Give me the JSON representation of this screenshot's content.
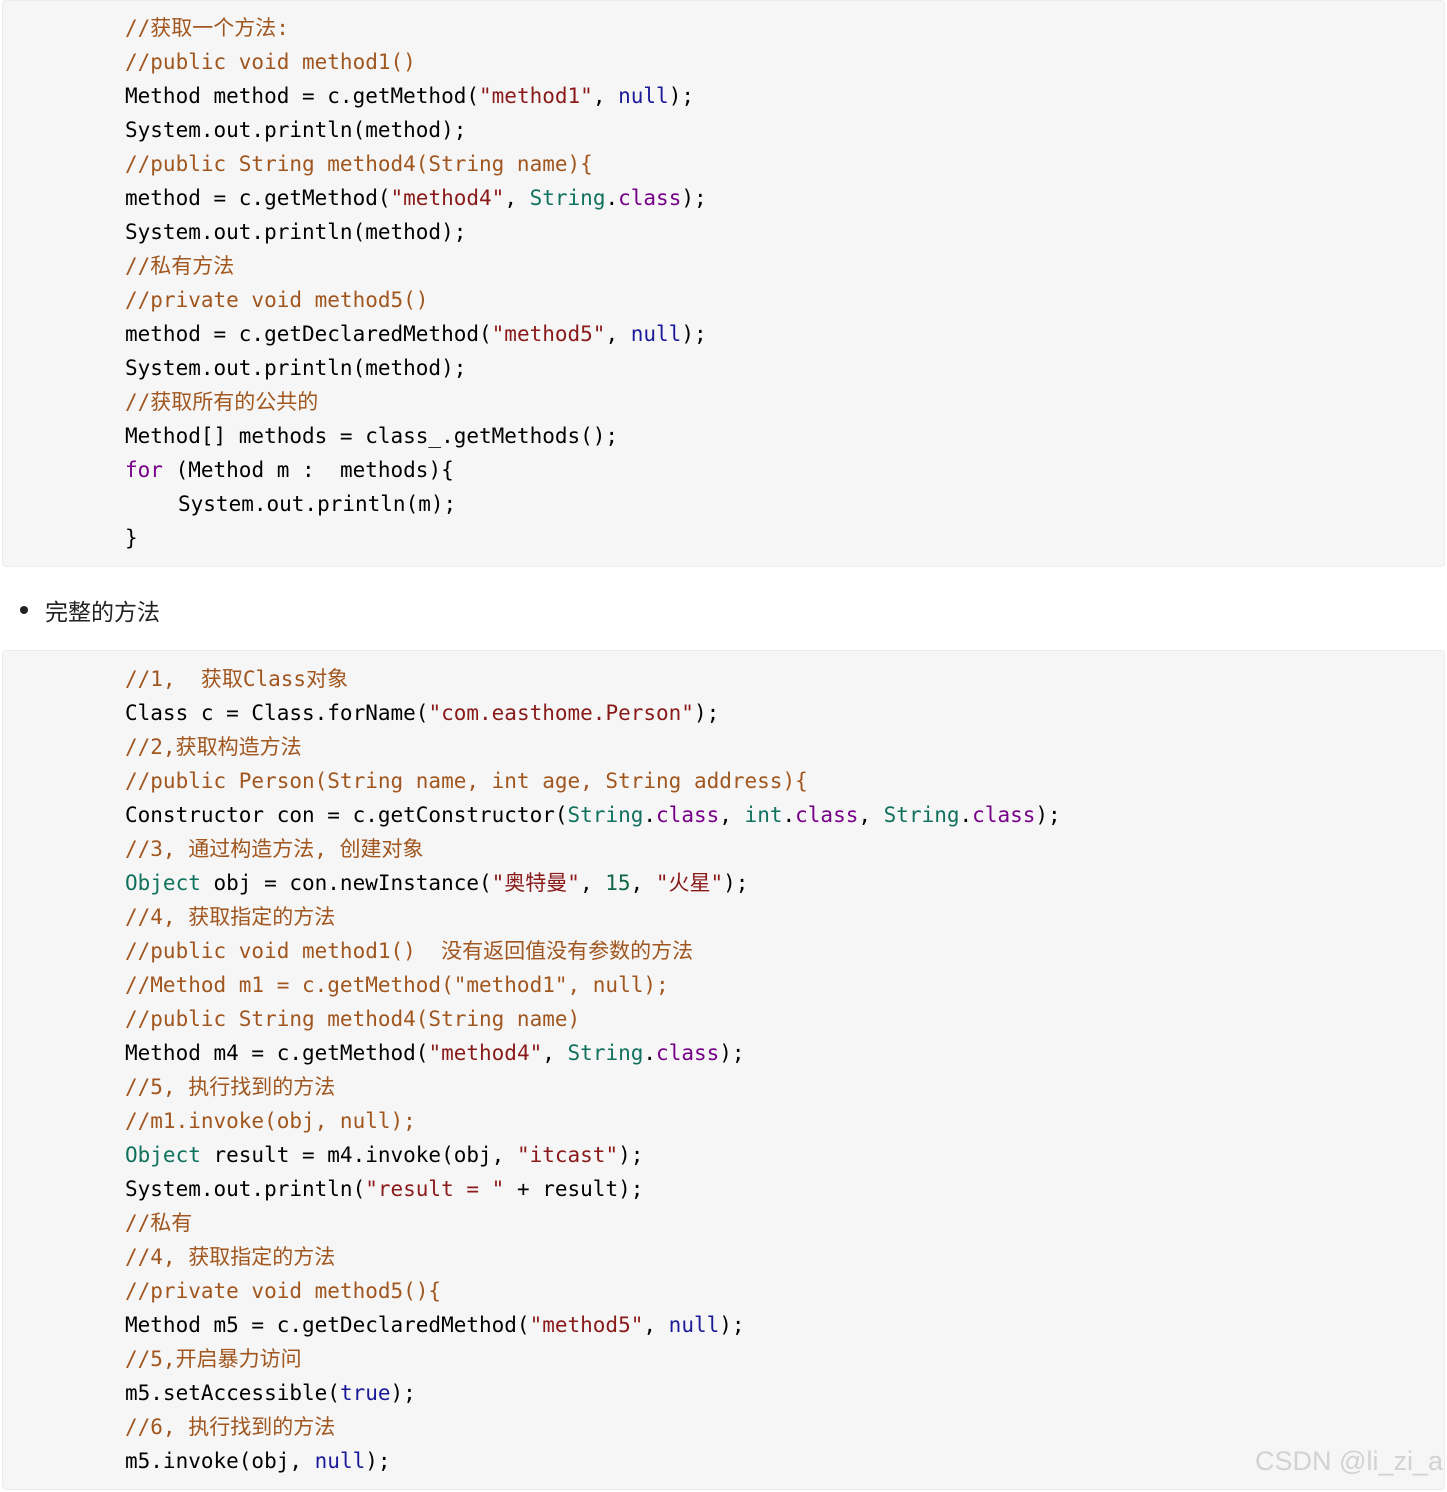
{
  "block1": {
    "lines": [
      {
        "indent": 0,
        "tokens": [
          {
            "t": "//获取一个方法:",
            "c": "comment"
          }
        ]
      },
      {
        "indent": 0,
        "tokens": [
          {
            "t": "//public void method1()",
            "c": "comment"
          }
        ]
      },
      {
        "indent": 0,
        "tokens": [
          {
            "t": "Method method = c.getMethod(",
            "c": ""
          },
          {
            "t": "\"method1\"",
            "c": "string"
          },
          {
            "t": ", ",
            "c": ""
          },
          {
            "t": "null",
            "c": "lit"
          },
          {
            "t": ");",
            "c": ""
          }
        ]
      },
      {
        "indent": 0,
        "tokens": [
          {
            "t": "System.out.println(method);",
            "c": ""
          }
        ]
      },
      {
        "indent": 0,
        "tokens": [
          {
            "t": "//public String method4(String name){",
            "c": "comment"
          }
        ]
      },
      {
        "indent": 0,
        "tokens": [
          {
            "t": "method = c.getMethod(",
            "c": ""
          },
          {
            "t": "\"method4\"",
            "c": "string"
          },
          {
            "t": ", ",
            "c": ""
          },
          {
            "t": "String",
            "c": "type"
          },
          {
            "t": ".",
            "c": ""
          },
          {
            "t": "class",
            "c": "kw"
          },
          {
            "t": ");",
            "c": ""
          }
        ]
      },
      {
        "indent": 0,
        "tokens": [
          {
            "t": "System.out.println(method);",
            "c": ""
          }
        ]
      },
      {
        "indent": 0,
        "tokens": [
          {
            "t": "//私有方法",
            "c": "comment"
          }
        ]
      },
      {
        "indent": 0,
        "tokens": [
          {
            "t": "//private void method5()",
            "c": "comment"
          }
        ]
      },
      {
        "indent": 0,
        "tokens": [
          {
            "t": "method = c.getDeclaredMethod(",
            "c": ""
          },
          {
            "t": "\"method5\"",
            "c": "string"
          },
          {
            "t": ", ",
            "c": ""
          },
          {
            "t": "null",
            "c": "lit"
          },
          {
            "t": ");",
            "c": ""
          }
        ]
      },
      {
        "indent": 0,
        "tokens": [
          {
            "t": "System.out.println(method);",
            "c": ""
          }
        ]
      },
      {
        "indent": 0,
        "tokens": [
          {
            "t": "//获取所有的公共的",
            "c": "comment"
          }
        ]
      },
      {
        "indent": 0,
        "tokens": [
          {
            "t": "Method[] methods = class_.getMethods();",
            "c": ""
          }
        ]
      },
      {
        "indent": 0,
        "tokens": [
          {
            "t": "for",
            "c": "kw"
          },
          {
            "t": " (Method m :  methods){",
            "c": ""
          }
        ]
      },
      {
        "indent": 1,
        "tokens": [
          {
            "t": "System.out.println(m);",
            "c": ""
          }
        ]
      },
      {
        "indent": 0,
        "tokens": [
          {
            "t": "}",
            "c": ""
          }
        ]
      }
    ]
  },
  "bullet": {
    "text": "完整的方法"
  },
  "block2": {
    "lines": [
      {
        "indent": 0,
        "tokens": [
          {
            "t": "//1,  获取Class对象",
            "c": "comment"
          }
        ]
      },
      {
        "indent": 0,
        "tokens": [
          {
            "t": "Class c = Class.forName(",
            "c": ""
          },
          {
            "t": "\"com.easthome.Person\"",
            "c": "string"
          },
          {
            "t": ");",
            "c": ""
          }
        ]
      },
      {
        "indent": 0,
        "tokens": [
          {
            "t": "//2,获取构造方法",
            "c": "comment"
          }
        ]
      },
      {
        "indent": 0,
        "tokens": [
          {
            "t": "//public Person(String name, int age, String address){",
            "c": "comment"
          }
        ]
      },
      {
        "indent": 0,
        "tokens": [
          {
            "t": "Constructor con = c.getConstructor(",
            "c": ""
          },
          {
            "t": "String",
            "c": "type"
          },
          {
            "t": ".",
            "c": ""
          },
          {
            "t": "class",
            "c": "kw"
          },
          {
            "t": ", ",
            "c": ""
          },
          {
            "t": "int",
            "c": "type"
          },
          {
            "t": ".",
            "c": ""
          },
          {
            "t": "class",
            "c": "kw"
          },
          {
            "t": ", ",
            "c": ""
          },
          {
            "t": "String",
            "c": "type"
          },
          {
            "t": ".",
            "c": ""
          },
          {
            "t": "class",
            "c": "kw"
          },
          {
            "t": ");",
            "c": ""
          }
        ]
      },
      {
        "indent": 0,
        "tokens": [
          {
            "t": "//3, 通过构造方法, 创建对象",
            "c": "comment"
          }
        ]
      },
      {
        "indent": 0,
        "tokens": [
          {
            "t": "Object",
            "c": "type"
          },
          {
            "t": " obj = con.newInstance(",
            "c": ""
          },
          {
            "t": "\"奥特曼\"",
            "c": "string"
          },
          {
            "t": ", ",
            "c": ""
          },
          {
            "t": "15",
            "c": "num"
          },
          {
            "t": ", ",
            "c": ""
          },
          {
            "t": "\"火星\"",
            "c": "string"
          },
          {
            "t": ");",
            "c": ""
          }
        ]
      },
      {
        "indent": 0,
        "tokens": [
          {
            "t": "//4, 获取指定的方法",
            "c": "comment"
          }
        ]
      },
      {
        "indent": 0,
        "tokens": [
          {
            "t": "//public void method1()  没有返回值没有参数的方法",
            "c": "comment"
          }
        ]
      },
      {
        "indent": 0,
        "tokens": [
          {
            "t": "//Method m1 = c.getMethod(\"method1\", null);",
            "c": "comment"
          }
        ]
      },
      {
        "indent": 0,
        "tokens": [
          {
            "t": "//public String method4(String name)",
            "c": "comment"
          }
        ]
      },
      {
        "indent": 0,
        "tokens": [
          {
            "t": "Method m4 = c.getMethod(",
            "c": ""
          },
          {
            "t": "\"method4\"",
            "c": "string"
          },
          {
            "t": ", ",
            "c": ""
          },
          {
            "t": "String",
            "c": "type"
          },
          {
            "t": ".",
            "c": ""
          },
          {
            "t": "class",
            "c": "kw"
          },
          {
            "t": ");",
            "c": ""
          }
        ]
      },
      {
        "indent": 0,
        "tokens": [
          {
            "t": "//5, 执行找到的方法",
            "c": "comment"
          }
        ]
      },
      {
        "indent": 0,
        "tokens": [
          {
            "t": "//m1.invoke(obj, null);",
            "c": "comment"
          }
        ]
      },
      {
        "indent": 0,
        "tokens": [
          {
            "t": "Object",
            "c": "type"
          },
          {
            "t": " result = m4.invoke(obj, ",
            "c": ""
          },
          {
            "t": "\"itcast\"",
            "c": "string"
          },
          {
            "t": ");",
            "c": ""
          }
        ]
      },
      {
        "indent": 0,
        "tokens": [
          {
            "t": "System.out.println(",
            "c": ""
          },
          {
            "t": "\"result = \"",
            "c": "string"
          },
          {
            "t": " + result);",
            "c": ""
          }
        ]
      },
      {
        "indent": 0,
        "tokens": [
          {
            "t": "//私有",
            "c": "comment"
          }
        ]
      },
      {
        "indent": 0,
        "tokens": [
          {
            "t": "//4, 获取指定的方法",
            "c": "comment"
          }
        ]
      },
      {
        "indent": 0,
        "tokens": [
          {
            "t": "//private void method5(){",
            "c": "comment"
          }
        ]
      },
      {
        "indent": 0,
        "tokens": [
          {
            "t": "Method m5 = c.getDeclaredMethod(",
            "c": ""
          },
          {
            "t": "\"method5\"",
            "c": "string"
          },
          {
            "t": ", ",
            "c": ""
          },
          {
            "t": "null",
            "c": "lit"
          },
          {
            "t": ");",
            "c": ""
          }
        ]
      },
      {
        "indent": 0,
        "tokens": [
          {
            "t": "//5,开启暴力访问",
            "c": "comment"
          }
        ]
      },
      {
        "indent": 0,
        "tokens": [
          {
            "t": "m5.setAccessible(",
            "c": ""
          },
          {
            "t": "true",
            "c": "lit"
          },
          {
            "t": ");",
            "c": ""
          }
        ]
      },
      {
        "indent": 0,
        "tokens": [
          {
            "t": "//6, 执行找到的方法",
            "c": "comment"
          }
        ]
      },
      {
        "indent": 0,
        "tokens": [
          {
            "t": "m5.invoke(obj, ",
            "c": ""
          },
          {
            "t": "null",
            "c": "lit"
          },
          {
            "t": ");",
            "c": ""
          }
        ]
      }
    ]
  },
  "watermark": {
    "text": "CSDN @li_zi_a"
  }
}
